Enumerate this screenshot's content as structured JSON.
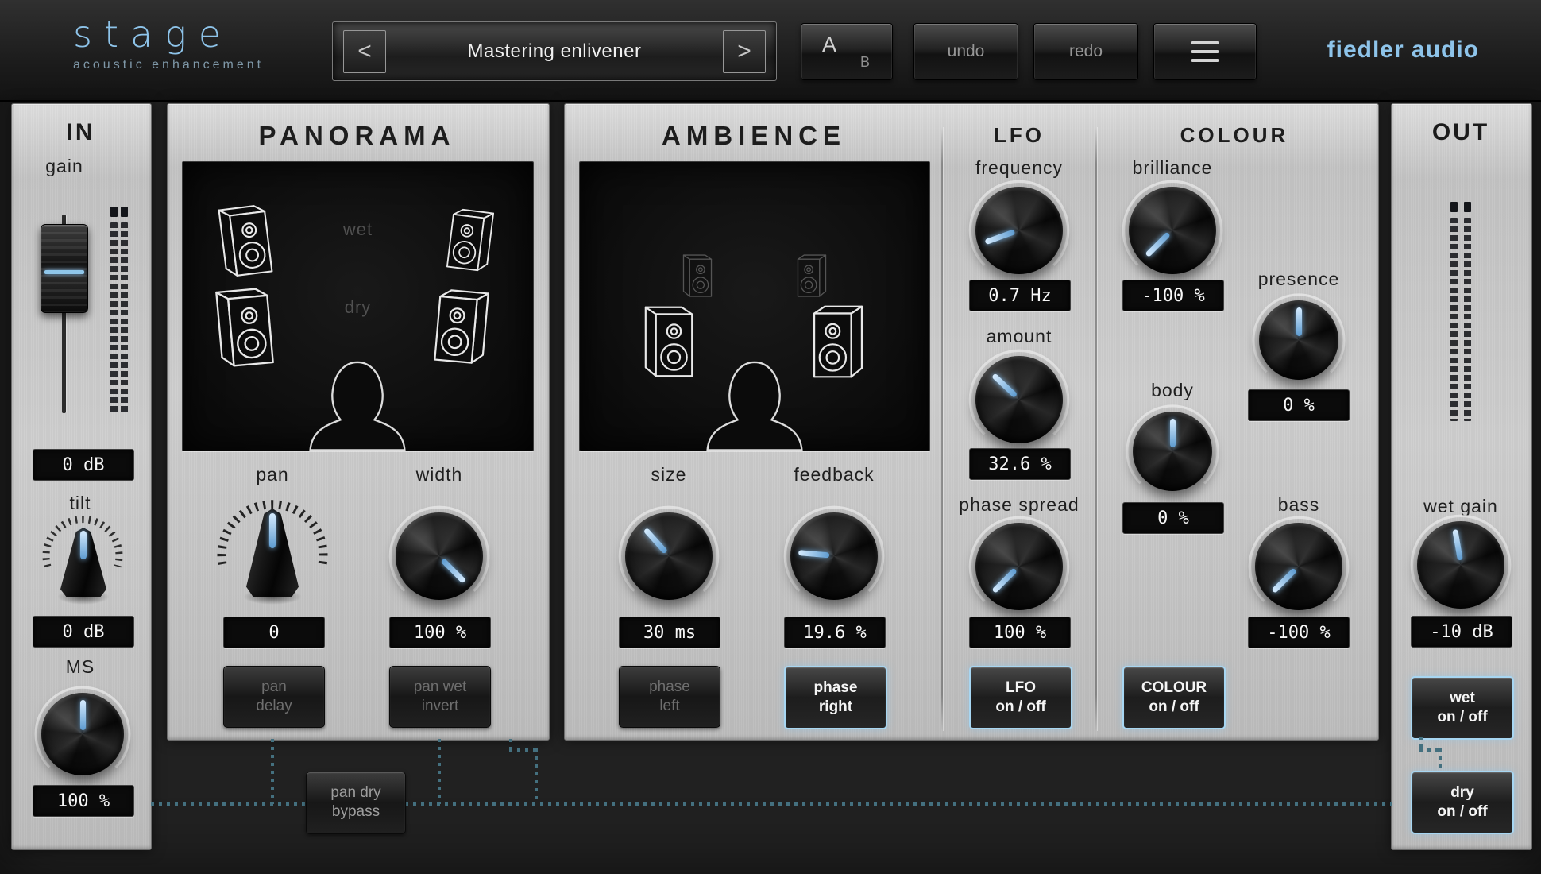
{
  "header": {
    "logo": "stage",
    "tagline": "acoustic enhancement",
    "preset_prev": "<",
    "preset_next": ">",
    "preset_name": "Mastering enlivener",
    "ab_a": "A",
    "ab_b": "B",
    "undo": "undo",
    "redo": "redo",
    "brand": "fiedler audio"
  },
  "in_panel": {
    "title": "IN",
    "gain_label": "gain",
    "gain_value": "0 dB",
    "tilt_label": "tilt",
    "tilt_value": "0 dB",
    "ms_label": "MS",
    "ms_value": "100 %"
  },
  "panorama": {
    "title": "PANORAMA",
    "wet_label": "wet",
    "dry_label": "dry",
    "pan_label": "pan",
    "pan_value": "0",
    "width_label": "width",
    "width_value": "100 %",
    "pan_delay": [
      "pan",
      "delay"
    ],
    "pan_wet_invert": [
      "pan wet",
      "invert"
    ]
  },
  "ambience": {
    "title": "AMBIENCE",
    "size_label": "size",
    "size_value": "30 ms",
    "feedback_label": "feedback",
    "feedback_value": "19.6 %",
    "phase_left": [
      "phase",
      "left"
    ],
    "phase_right": [
      "phase",
      "right"
    ]
  },
  "lfo": {
    "title": "LFO",
    "frequency_label": "frequency",
    "frequency_value": "0.7 Hz",
    "amount_label": "amount",
    "amount_value": "32.6 %",
    "phase_spread_label": "phase spread",
    "phase_spread_value": "100 %",
    "onoff": [
      "LFO",
      "on / off"
    ]
  },
  "colour": {
    "title": "COLOUR",
    "brilliance_label": "brilliance",
    "brilliance_value": "-100 %",
    "presence_label": "presence",
    "presence_value": "0 %",
    "body_label": "body",
    "body_value": "0 %",
    "bass_label": "bass",
    "bass_value": "-100 %",
    "onoff": [
      "COLOUR",
      "on / off"
    ]
  },
  "out_panel": {
    "title": "OUT",
    "wet_gain_label": "wet gain",
    "wet_gain_value": "-10 dB",
    "wet_onoff": [
      "wet",
      "on / off"
    ],
    "dry_onoff": [
      "dry",
      "on / off"
    ]
  },
  "bypass_button": [
    "pan dry",
    "bypass"
  ],
  "colors": {
    "accent": "#8ec4ea",
    "pointer": "#7db6e8",
    "panel": "#c8c8c8",
    "display_bg": "#0d0d0d",
    "routing_dots": "#44707f"
  },
  "knob_angles": {
    "tilt": 0,
    "ms": 0,
    "pan": 0,
    "width": 135,
    "size": -42,
    "feedback": -85,
    "frequency": -110,
    "amount": -47,
    "phase_spread": -135,
    "brilliance": -135,
    "presence": 0,
    "body": 0,
    "bass": -135,
    "wet_gain": -10
  }
}
